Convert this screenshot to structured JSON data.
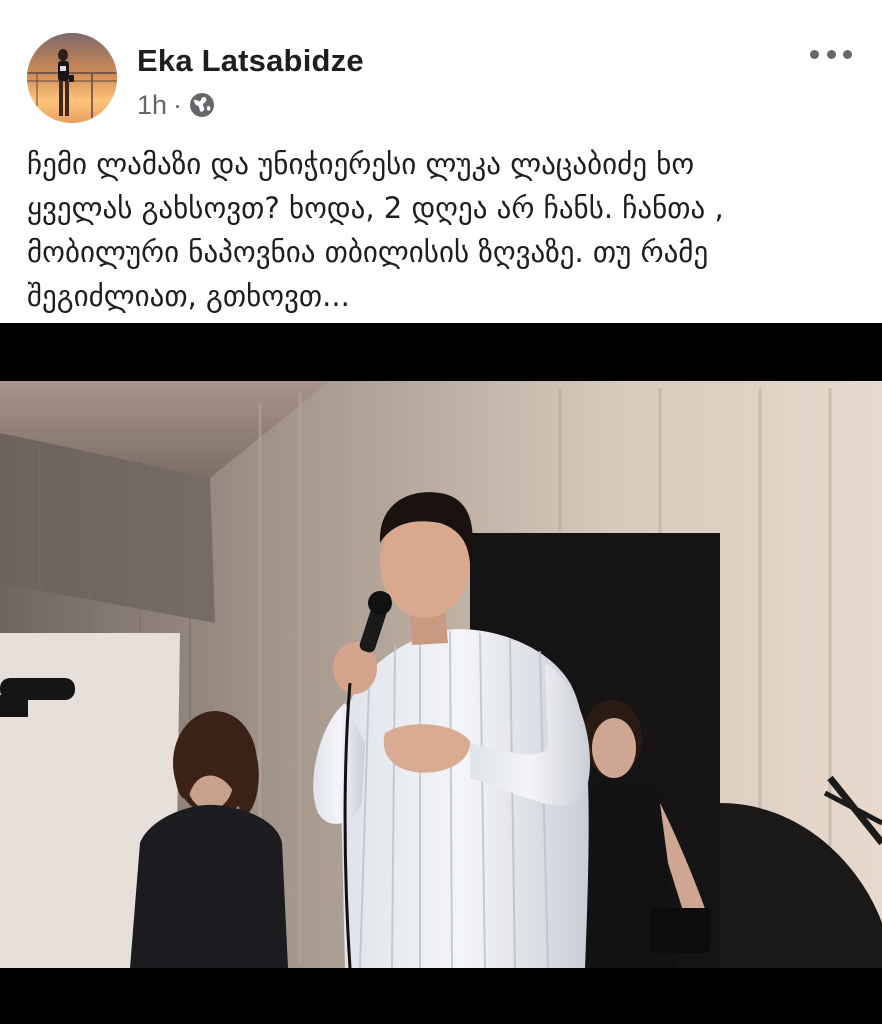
{
  "post": {
    "author": "Eka Latsabidze",
    "time": "1h",
    "separator": "·",
    "privacy_icon": "globe-icon",
    "more_icon": "more-options-icon",
    "text_lines": [
      "ჩემი ლამაზი და უნიჭიერესი ლუკა ლაცაბიძე ხო",
      "ყველას გახსოვთ? ხოდა, 2 დღეა არ ჩანს. ჩანთა ,",
      "მობილური ნაპოვნია თბილისის ზღვაზე. თუ რამე",
      "შეგიძლიათ, გთხოვთ..."
    ]
  },
  "colors": {
    "name_text": "#1c1e21",
    "meta_text": "#65676b",
    "photo_border": "#000000"
  }
}
